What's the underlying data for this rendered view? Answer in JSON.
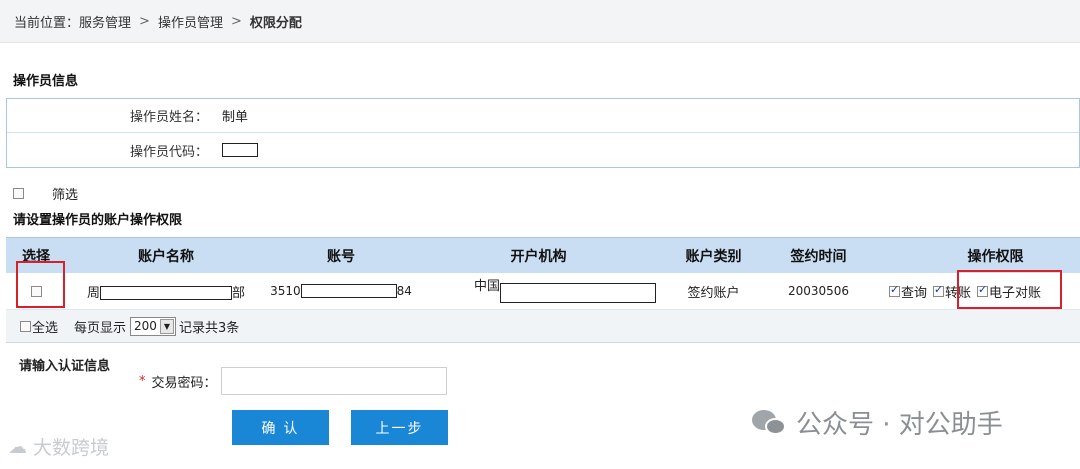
{
  "breadcrumb": {
    "prefix": "当前位置：",
    "items": [
      "服务管理",
      "操作员管理"
    ],
    "separator": ">",
    "current": "权限分配"
  },
  "operator_section": {
    "title": "操作员信息",
    "name_label": "操作员姓名：",
    "name_value": "制单",
    "code_label": "操作员代码："
  },
  "filter": {
    "checked": false,
    "label": "筛选"
  },
  "permission_section": {
    "title": "请设置操作员的账户操作权限"
  },
  "table": {
    "headers": [
      "选择",
      "账户名称",
      "账号",
      "开户机构",
      "账户类别",
      "签约时间",
      "操作权限"
    ],
    "rows": [
      {
        "selected": false,
        "account_name_prefix": "周",
        "account_name_suffix": "部",
        "account_no_prefix": "3510",
        "account_no_suffix": "84",
        "institution_prefix": "中国",
        "account_type": "签约账户",
        "sign_date": "20030506",
        "permissions": [
          {
            "label": "查询",
            "checked": true
          },
          {
            "label": "转账",
            "checked": true
          },
          {
            "label": "电子对账",
            "checked": true
          }
        ]
      }
    ],
    "footer": {
      "select_all": "全选",
      "page_size_prefix": "每页显示",
      "page_size": "200",
      "records_text": "记录共3条"
    }
  },
  "auth": {
    "title": "请输入认证信息",
    "required_mark": "*",
    "password_label": "交易密码：",
    "password_value": ""
  },
  "buttons": {
    "confirm": "确 认",
    "back": "上一步"
  },
  "watermarks": {
    "right": "公众号 · 对公助手",
    "left": "大数跨境"
  },
  "colors": {
    "accent": "#1a87d6",
    "header_bg": "#c9def2",
    "highlight": "#d6202a"
  }
}
